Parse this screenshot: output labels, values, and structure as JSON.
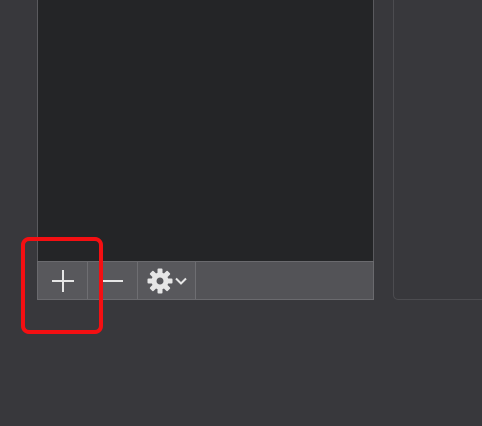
{
  "toolbar": {
    "add_icon": "plus-icon",
    "remove_icon": "minus-icon",
    "settings_icon": "gear-icon",
    "settings_dropdown_icon": "chevron-down-icon"
  },
  "colors": {
    "background": "#38383c",
    "list_background": "#242527",
    "toolbar_background": "#535357",
    "icon_color": "#e6e6e6",
    "highlight": "#f40f12"
  }
}
